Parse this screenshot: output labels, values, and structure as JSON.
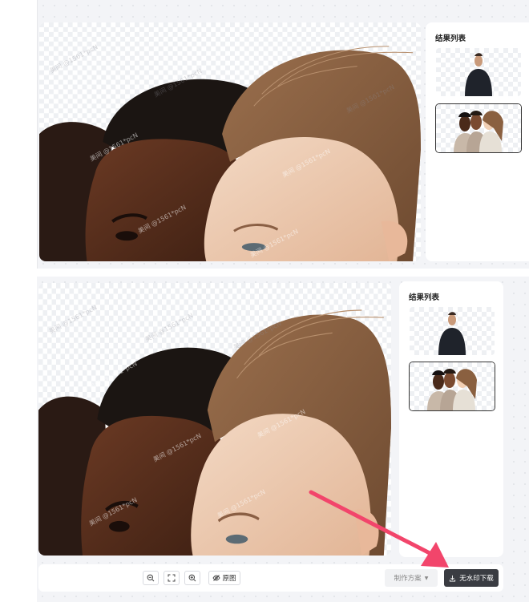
{
  "results_panel": {
    "title": "结果列表"
  },
  "watermark_text": "美间 @1561*pcN",
  "toolbar": {
    "zoom_out_icon": "zoom-out-icon",
    "fit_icon": "fit-screen-icon",
    "zoom_in_icon": "zoom-in-icon",
    "original_label": "原图",
    "original_icon": "eye-off-icon",
    "scheme_label": "制作方案",
    "download_label": "无水印下载",
    "download_icon": "download-icon"
  },
  "colors": {
    "annotation_arrow": "#f2456b",
    "download_button": "#3a3c42",
    "canvas_bg": "#f3f4f7"
  }
}
